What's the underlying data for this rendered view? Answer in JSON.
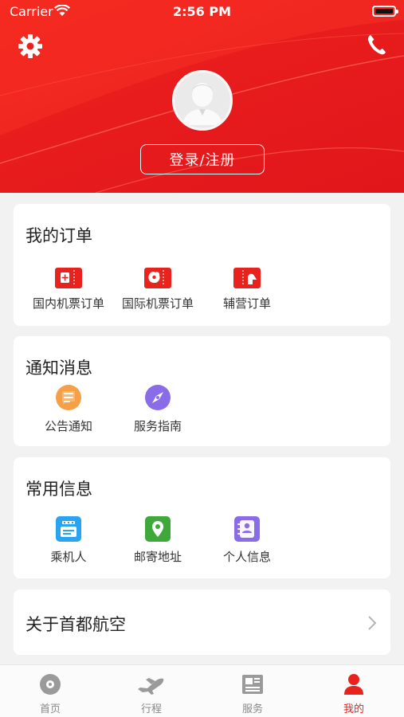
{
  "status_bar": {
    "carrier": "Carrier",
    "time": "2:56 PM"
  },
  "header": {
    "settings_icon": "gear-icon",
    "phone_icon": "phone-icon",
    "avatar_icon": "user-avatar-icon",
    "login_label": "登录/注册"
  },
  "orders": {
    "title": "我的订单",
    "items": [
      {
        "label": "国内机票订单",
        "icon": "domestic-ticket-icon"
      },
      {
        "label": "国际机票订单",
        "icon": "international-ticket-icon"
      },
      {
        "label": "辅营订单",
        "icon": "ancillary-ticket-icon"
      }
    ]
  },
  "notices": {
    "title": "通知消息",
    "items": [
      {
        "label": "公告通知",
        "icon": "announcement-icon",
        "color": "#f5a046"
      },
      {
        "label": "服务指南",
        "icon": "compass-icon",
        "color": "#8a6be8"
      }
    ]
  },
  "common_info": {
    "title": "常用信息",
    "items": [
      {
        "label": "乘机人",
        "icon": "passenger-card-icon",
        "color": "#2aa3f0"
      },
      {
        "label": "邮寄地址",
        "icon": "map-pin-icon",
        "color": "#3fa83a"
      },
      {
        "label": "个人信息",
        "icon": "contact-card-icon",
        "color": "#8a6be8"
      }
    ]
  },
  "about": {
    "label": "关于首都航空"
  },
  "tabbar": {
    "tabs": [
      {
        "label": "首页",
        "icon": "home-disc-icon"
      },
      {
        "label": "行程",
        "icon": "airplane-icon"
      },
      {
        "label": "服务",
        "icon": "service-newspaper-icon"
      },
      {
        "label": "我的",
        "icon": "profile-icon",
        "active": true
      }
    ]
  },
  "colors": {
    "brand_red": "#e8221d",
    "background": "#f2f2f2",
    "tab_inactive": "#888888"
  }
}
